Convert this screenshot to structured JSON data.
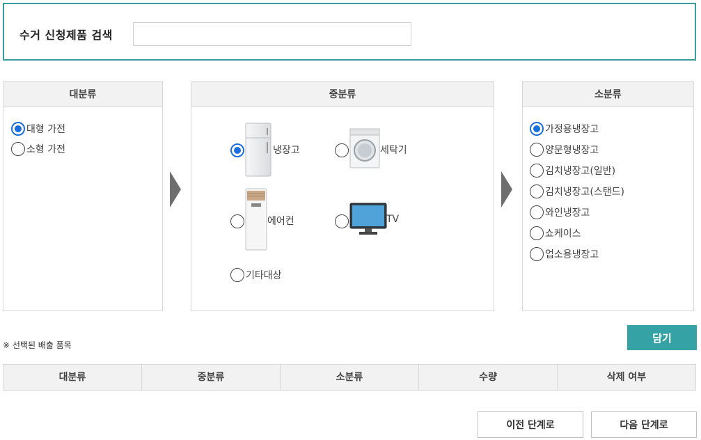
{
  "search": {
    "label": "수거 신청제품 검색",
    "value": "",
    "placeholder": ""
  },
  "major": {
    "header": "대분류",
    "options": [
      {
        "label": "대형 가전",
        "selected": true
      },
      {
        "label": "소형 가전",
        "selected": false
      }
    ]
  },
  "middle": {
    "header": "중분류",
    "options": [
      {
        "label": "냉장고",
        "icon": "refrigerator-icon",
        "selected": true
      },
      {
        "label": "세탁기",
        "icon": "washing-machine-icon",
        "selected": false
      },
      {
        "label": "에어컨",
        "icon": "air-conditioner-icon",
        "selected": false
      },
      {
        "label": "TV",
        "icon": "tv-icon",
        "selected": false
      },
      {
        "label": "기타대상",
        "icon": "",
        "selected": false
      }
    ]
  },
  "minor": {
    "header": "소분류",
    "options": [
      {
        "label": "가정용냉장고",
        "selected": true
      },
      {
        "label": "양문형냉장고",
        "selected": false
      },
      {
        "label": "김치냉장고(일반)",
        "selected": false
      },
      {
        "label": "김치냉장고(스탠드)",
        "selected": false
      },
      {
        "label": "와인냉장고",
        "selected": false
      },
      {
        "label": "쇼케이스",
        "selected": false
      },
      {
        "label": "업소용냉장고",
        "selected": false
      }
    ]
  },
  "selected_items": {
    "notice": "※ 선택된 배출 품목",
    "add_label": "담기",
    "columns": [
      "대분류",
      "중분류",
      "소분류",
      "수량",
      "삭제 여부"
    ]
  },
  "nav": {
    "prev_label": "이전 단계로",
    "next_label": "다음 단계로"
  },
  "colors": {
    "accent": "#35a3a5",
    "border_accent": "#3a9c9c",
    "radio_selected": "#1a6fdc",
    "header_bg": "#f2f2f2"
  }
}
